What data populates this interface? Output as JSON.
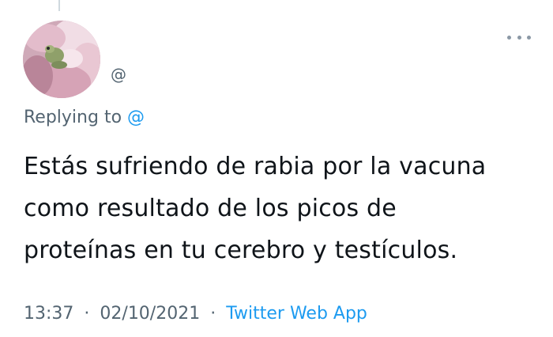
{
  "tweet": {
    "handle": "@",
    "replying_prefix": "Replying to ",
    "replying_mention": "@",
    "body_lines": [
      "Estás sufriendo de rabia por la vacuna",
      "como resultado de los picos de",
      "proteínas en tu cerebro y testículos."
    ],
    "time": "13:37",
    "separator": "·",
    "date": "02/10/2021",
    "source": "Twitter Web App"
  },
  "icons": {
    "avatar": "flower-frog-avatar",
    "more": "more-dots-icon"
  },
  "colors": {
    "text": "#0f1419",
    "secondary": "#536471",
    "link": "#1d9bf0",
    "background": "#ffffff"
  }
}
